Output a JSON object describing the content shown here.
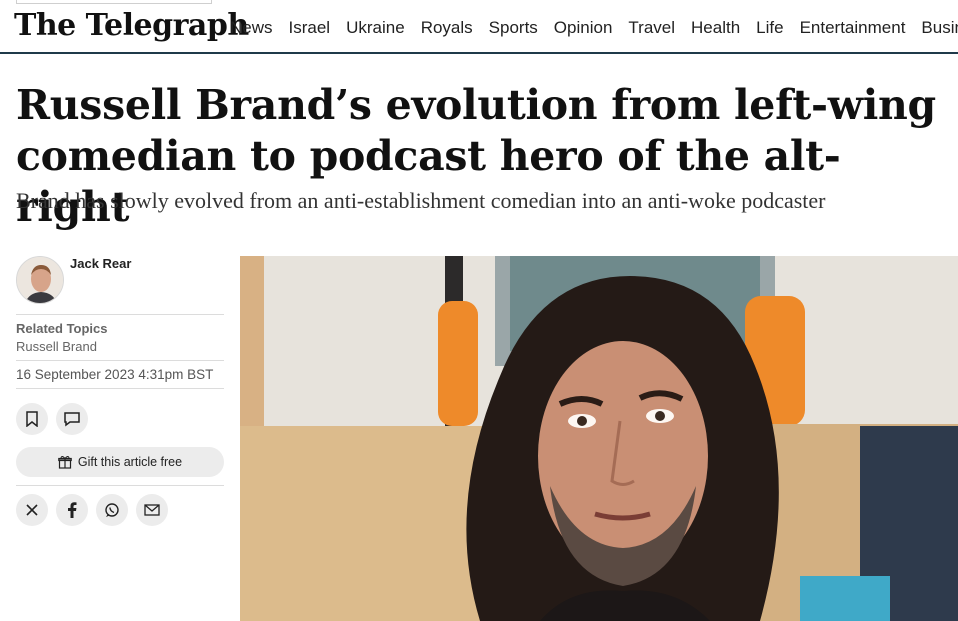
{
  "header": {
    "logo": "The Telegraph",
    "nav": [
      "News",
      "Israel",
      "Ukraine",
      "Royals",
      "Sports",
      "Opinion",
      "Travel",
      "Health",
      "Life",
      "Entertainment",
      "Business"
    ]
  },
  "article": {
    "headline": "Russell Brand’s evolution from left-wing comedian to podcast hero of the alt-right",
    "standfirst": "Brand has slowly evolved from an anti-establishment comedian into an anti-woke podcaster"
  },
  "sidebar": {
    "author": "Jack Rear",
    "related_topics_label": "Related Topics",
    "related_topic": "Russell Brand",
    "date": "16 September 2023 4:31pm BST",
    "gift_label": "Gift this article free",
    "actions": [
      "bookmark-icon",
      "comment-icon"
    ],
    "share": [
      "x-icon",
      "facebook-icon",
      "whatsapp-icon",
      "email-icon"
    ]
  },
  "colors": {
    "header_rule": "#1f3a4a",
    "button_bg": "#ececec"
  }
}
